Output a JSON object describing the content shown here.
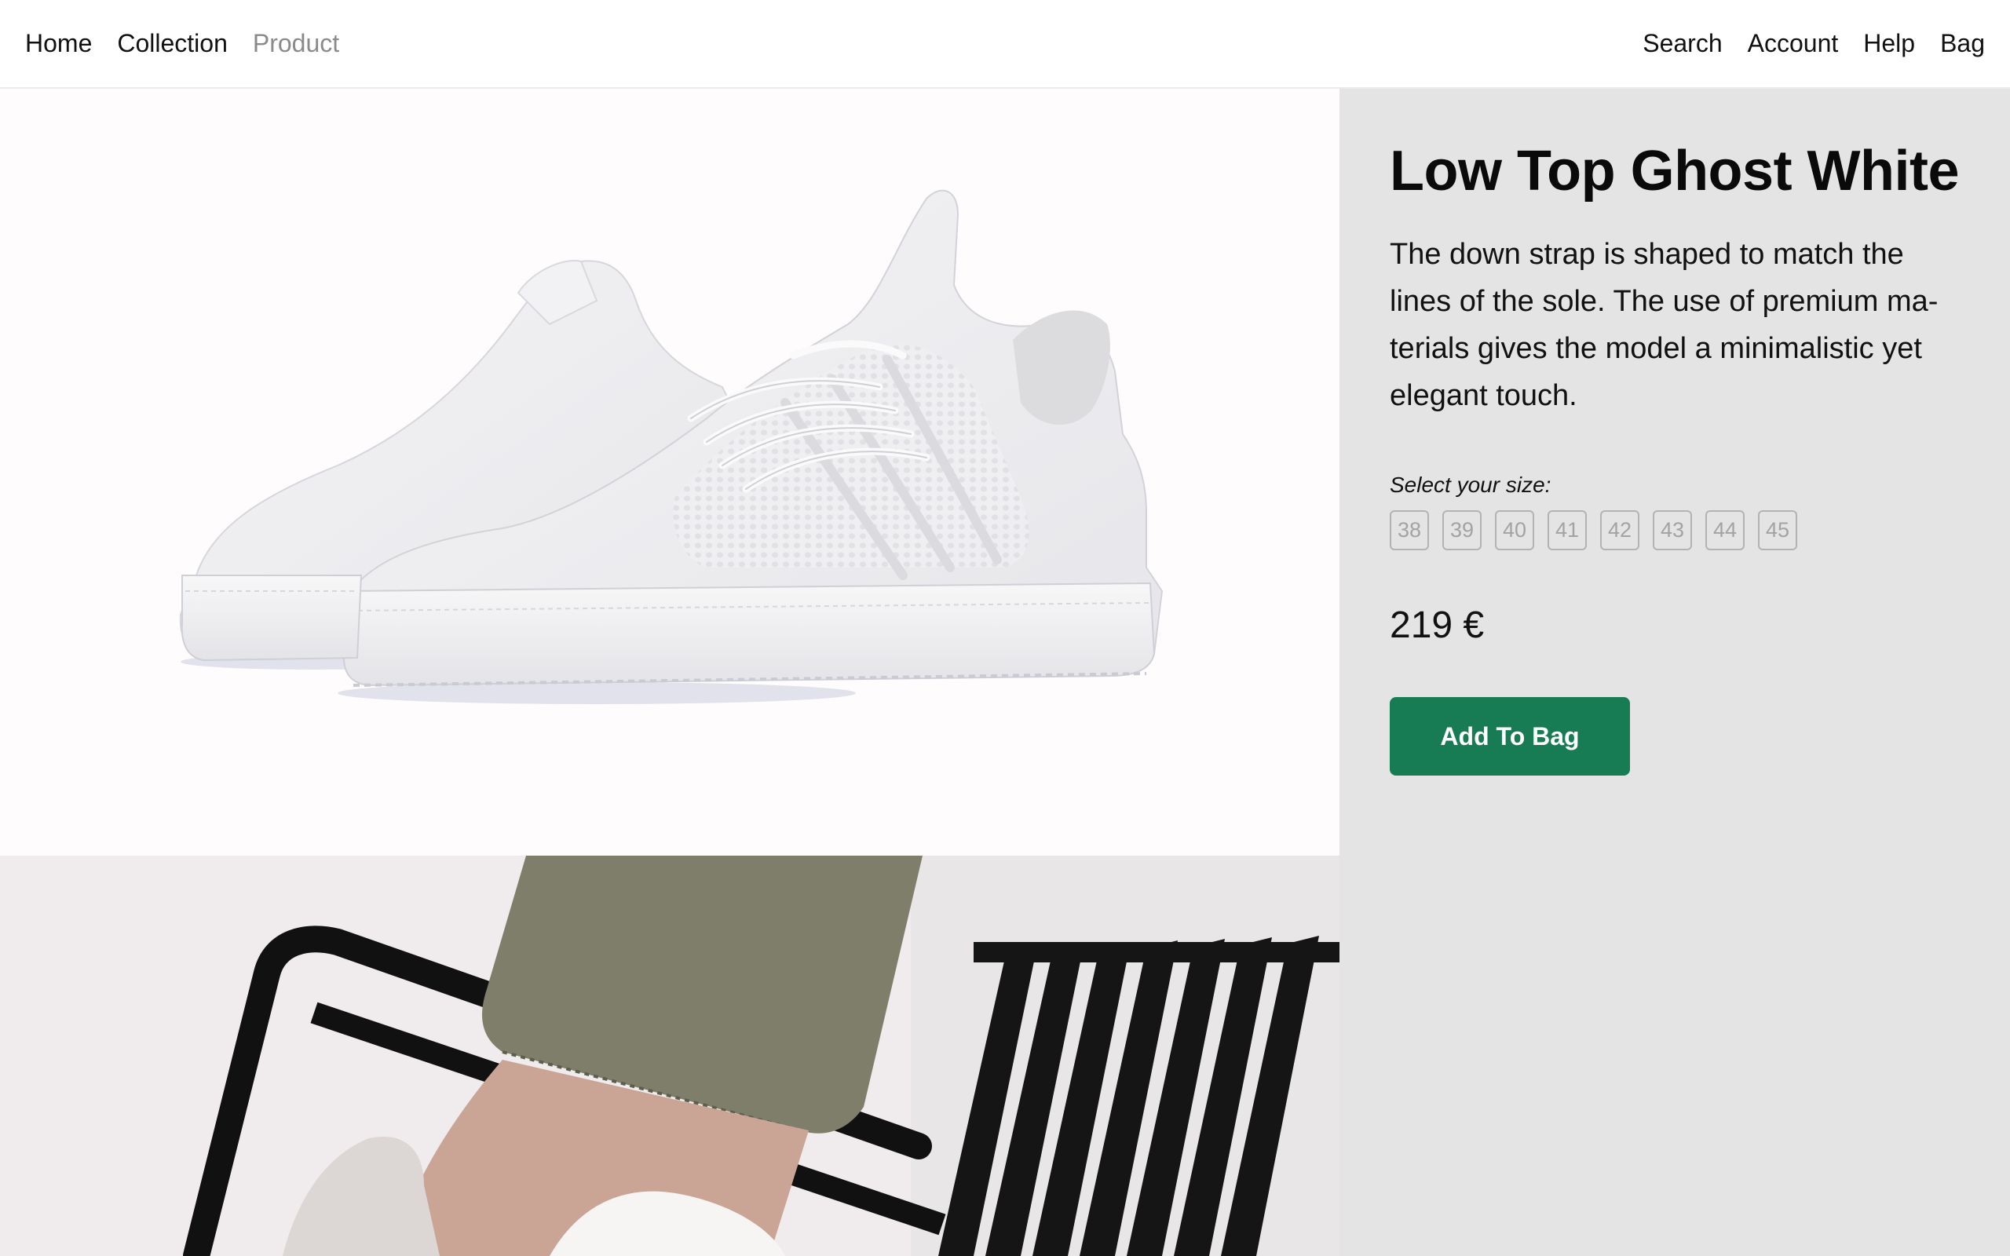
{
  "nav": {
    "left": [
      {
        "label": "Home"
      },
      {
        "label": "Collection"
      },
      {
        "label": "Product"
      }
    ],
    "right": [
      {
        "label": "Search"
      },
      {
        "label": "Account"
      },
      {
        "label": "Help"
      },
      {
        "label": "Bag"
      }
    ]
  },
  "product": {
    "title": "Low Top Ghost White",
    "description": "The down strap is shaped to match the lines of the sole. The use of premium ma-terials gives the model a minimalistic yet elegant touch.",
    "size_label": "Select your size:",
    "sizes": [
      "38",
      "39",
      "40",
      "41",
      "42",
      "43",
      "44",
      "45"
    ],
    "price": "219 €",
    "add_to_bag_label": "Add To Bag"
  },
  "colors": {
    "accent": "#177b53",
    "panel_bg": "#e4e4e4",
    "nav_current": "#8a8a8a"
  }
}
